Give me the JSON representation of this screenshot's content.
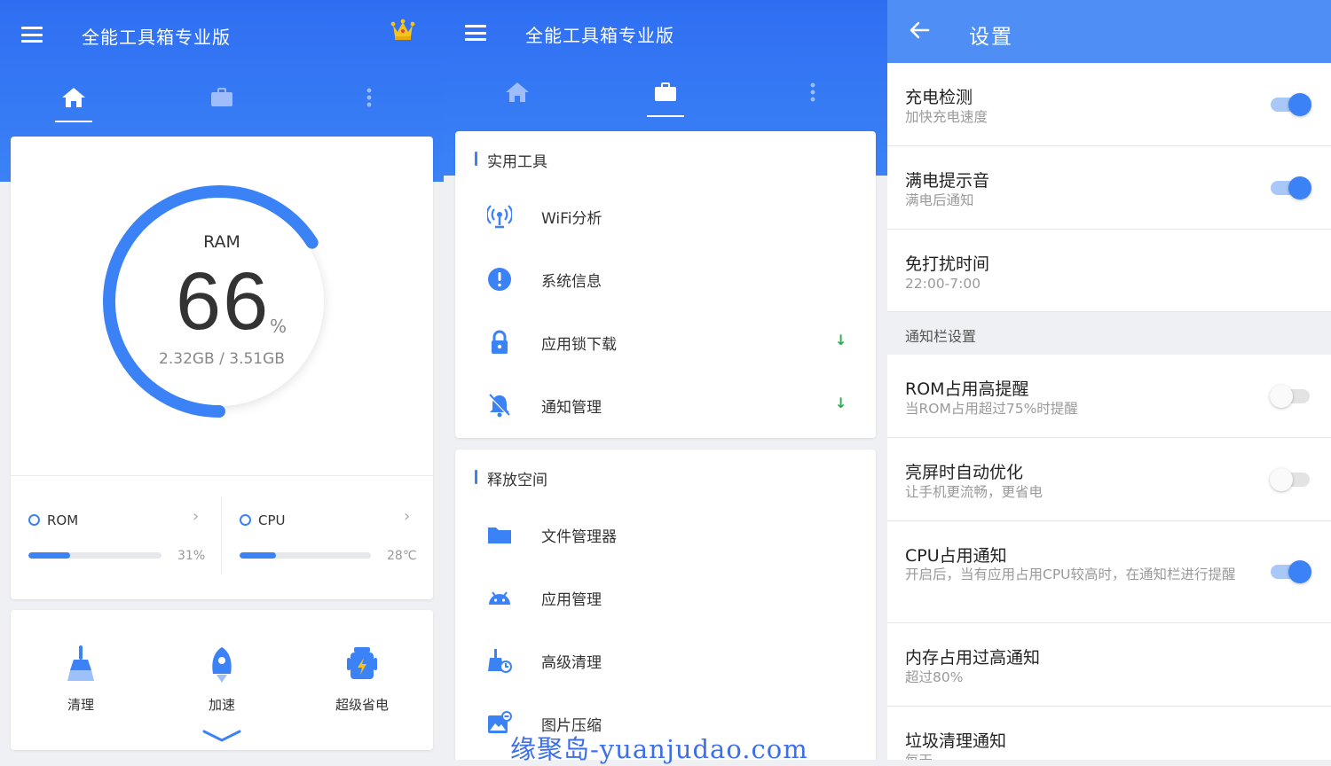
{
  "home": {
    "title": "全能工具箱专业版",
    "tabs": [
      "home-icon",
      "briefcase-icon",
      "more-icon"
    ],
    "ram": {
      "label": "RAM",
      "value": "66",
      "unit": "%",
      "usage": "2.32GB / 3.51GB",
      "percent": 66
    },
    "rom": {
      "label": "ROM",
      "value": "31%",
      "percent": 31
    },
    "cpu": {
      "label": "CPU",
      "value": "28℃",
      "percent": 28
    },
    "actions": [
      {
        "label": "清理",
        "icon": "broom-icon"
      },
      {
        "label": "加速",
        "icon": "rocket-icon"
      },
      {
        "label": "超级省电",
        "icon": "battery-robot-icon"
      }
    ],
    "accent": "#3b82f6"
  },
  "tools": {
    "title": "全能工具箱专业版",
    "sections": [
      {
        "title": "实用工具",
        "items": [
          {
            "label": "WiFi分析",
            "icon": "wifi-antenna-icon",
            "download": false
          },
          {
            "label": "系统信息",
            "icon": "info-icon",
            "download": false
          },
          {
            "label": "应用锁下载",
            "icon": "lock-icon",
            "download": true
          },
          {
            "label": "通知管理",
            "icon": "bell-off-icon",
            "download": true
          }
        ]
      },
      {
        "title": "释放空间",
        "items": [
          {
            "label": "文件管理器",
            "icon": "folder-icon"
          },
          {
            "label": "应用管理",
            "icon": "android-icon"
          },
          {
            "label": "高级清理",
            "icon": "broom-clean-icon"
          },
          {
            "label": "图片压缩",
            "icon": "image-icon"
          }
        ]
      }
    ],
    "download_glyph": "↓"
  },
  "settings": {
    "title": "设置",
    "group_label": "通知栏设置",
    "rows": [
      {
        "title": "充电检测",
        "subtitle": "加快充电速度",
        "on": true
      },
      {
        "title": "满电提示音",
        "subtitle": "满电后通知",
        "on": true
      },
      {
        "title": "免打扰时间",
        "subtitle": "22:00-7:00"
      },
      {
        "title": "ROM占用高提醒",
        "subtitle": "当ROM占用超过75%时提醒",
        "on": false
      },
      {
        "title": "亮屏时自动优化",
        "subtitle": "让手机更流畅，更省电",
        "on": false
      },
      {
        "title": "CPU占用通知",
        "subtitle": "开启后，当有应用占用CPU较高时，在通知栏进行提醒",
        "on": true
      },
      {
        "title": "内存占用过高通知",
        "subtitle": "超过80%"
      },
      {
        "title": "垃圾清理通知",
        "subtitle": "每天"
      }
    ]
  },
  "watermark": "缘聚岛-yuanjudao.com"
}
